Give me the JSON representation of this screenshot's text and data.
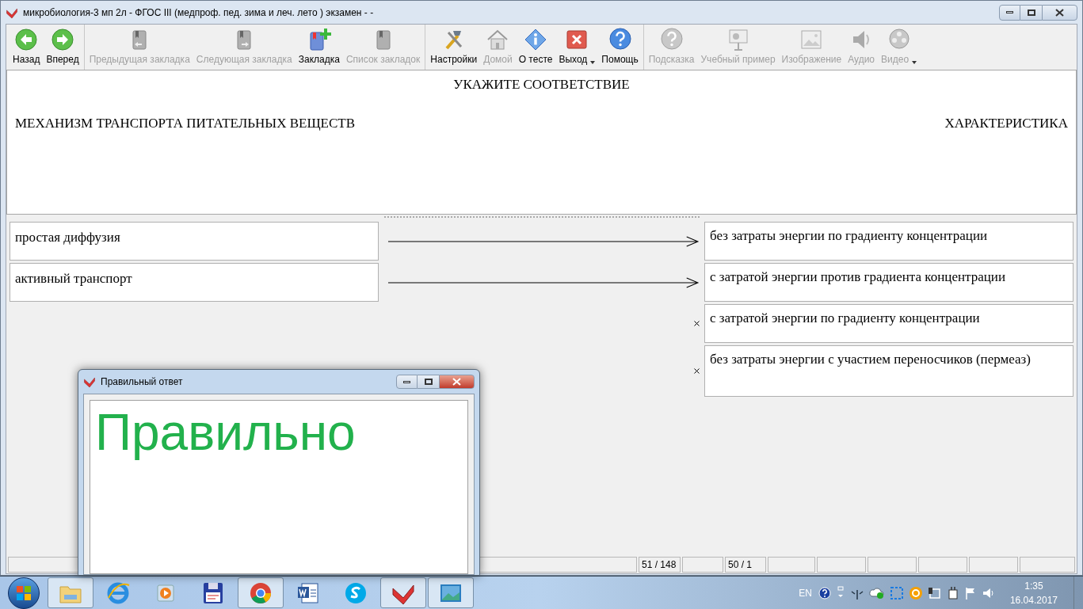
{
  "window": {
    "title": "микробиология-3 мп 2л - ФГОС III (медпроф. пед. зима и леч. лето ) экзамен -  -"
  },
  "toolbar": {
    "groups": [
      [
        {
          "kind": "back",
          "label": "Назад",
          "disabled": false,
          "dropdown": false
        },
        {
          "kind": "forward",
          "label": "Вперед",
          "disabled": false,
          "dropdown": false
        }
      ],
      [
        {
          "kind": "bookmark-prev",
          "label": "Предыдущая закладка",
          "disabled": true,
          "dropdown": false
        },
        {
          "kind": "bookmark-next",
          "label": "Следующая закладка",
          "disabled": true,
          "dropdown": false
        },
        {
          "kind": "bookmark-add",
          "label": "Закладка",
          "disabled": false,
          "dropdown": false
        },
        {
          "kind": "bookmark-list",
          "label": "Список закладок",
          "disabled": true,
          "dropdown": false
        }
      ],
      [
        {
          "kind": "settings",
          "label": "Настройки",
          "disabled": false,
          "dropdown": false
        },
        {
          "kind": "home",
          "label": "Домой",
          "disabled": true,
          "dropdown": false
        },
        {
          "kind": "info",
          "label": "О тесте",
          "disabled": false,
          "dropdown": false
        },
        {
          "kind": "exit",
          "label": "Выход",
          "disabled": false,
          "dropdown": true
        },
        {
          "kind": "help",
          "label": "Помощь",
          "disabled": false,
          "dropdown": false
        }
      ],
      [
        {
          "kind": "hint",
          "label": "Подсказка",
          "disabled": true,
          "dropdown": false
        },
        {
          "kind": "example",
          "label": "Учебный пример",
          "disabled": true,
          "dropdown": false
        },
        {
          "kind": "image",
          "label": "Изображение",
          "disabled": true,
          "dropdown": false
        },
        {
          "kind": "audio",
          "label": "Аудио",
          "disabled": true,
          "dropdown": false
        },
        {
          "kind": "video",
          "label": "Видео",
          "disabled": true,
          "dropdown": true
        }
      ]
    ]
  },
  "question": {
    "title": "УКАЖИТЕ СООТВЕТСТВИЕ",
    "left_heading": "МЕХАНИЗМ ТРАНСПОРТА ПИТАТЕЛЬНЫХ ВЕЩЕСТВ",
    "right_heading": "ХАРАКТЕРИСТИКА"
  },
  "matching": {
    "left": [
      "простая диффузия",
      "активный транспорт"
    ],
    "right": [
      {
        "text": "без затраты энергии по градиенту концентрации",
        "matched": true
      },
      {
        "text": "с затратой энергии против градиента концентрации",
        "matched": true
      },
      {
        "text": "с затратой энергии по градиенту концентрации",
        "matched": false
      },
      {
        "text": "без затраты энергии с участием переносчиков (пермеаз)",
        "matched": false
      }
    ]
  },
  "status_bar": [
    "51 / 148",
    "50 / 1"
  ],
  "dialog": {
    "title": "Правильный ответ",
    "message": "Правильно"
  },
  "taskbar": {
    "apps": [
      {
        "kind": "folder",
        "open": true
      },
      {
        "kind": "browser-e",
        "open": false
      },
      {
        "kind": "media",
        "open": false
      },
      {
        "kind": "floppy",
        "open": false
      },
      {
        "kind": "chrome",
        "open": true
      },
      {
        "kind": "word",
        "open": false
      },
      {
        "kind": "skype",
        "open": false
      },
      {
        "kind": "check",
        "open": true
      },
      {
        "kind": "photo",
        "open": true
      }
    ],
    "language": "EN",
    "time": "1:35",
    "date": "16.04.2017"
  }
}
